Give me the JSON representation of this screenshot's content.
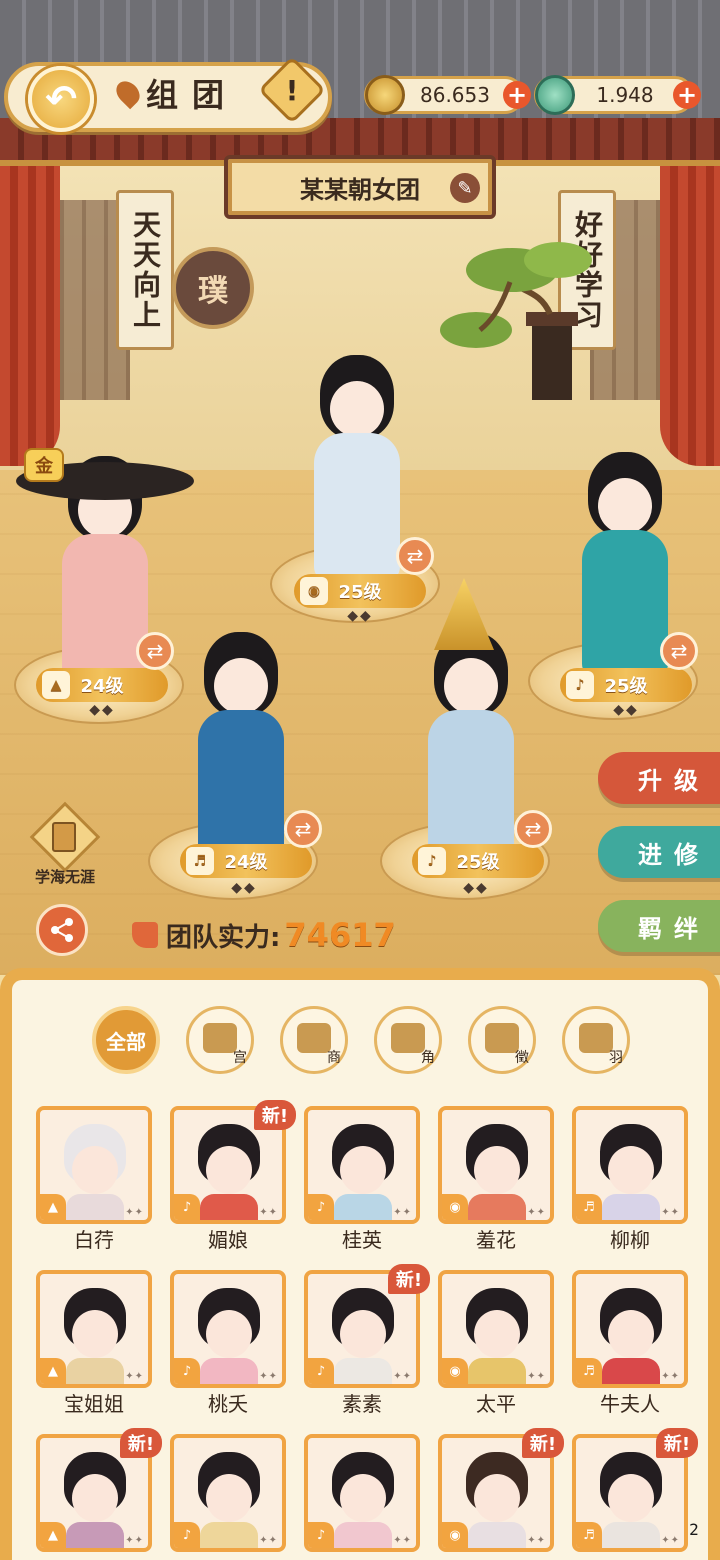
{
  "header": {
    "title": "组团",
    "info_label": "!",
    "back_label": "↶"
  },
  "currency": {
    "coins": "86.653",
    "jade": "1.948",
    "plus": "+"
  },
  "team": {
    "name": "某某朝女团",
    "banner_left": "天天向上",
    "banner_right": "好好学习",
    "seal": "璞",
    "gold_badge": "金"
  },
  "stage": {
    "members": [
      {
        "level": "25级",
        "stars": "◆◆",
        "color": "#dbe7f1"
      },
      {
        "level": "24级",
        "stars": "◆◆",
        "color": "#f2b7b0"
      },
      {
        "level": "25级",
        "stars": "◆◆",
        "color": "#2fa4a6"
      },
      {
        "level": "24级",
        "stars": "◆◆",
        "color": "#2f73a9"
      },
      {
        "level": "25级",
        "stars": "◆◆",
        "color": "#bcd4e6"
      }
    ]
  },
  "side_buttons": {
    "upgrade": "升级",
    "train": "进修",
    "bond": "羁绊"
  },
  "study_label": "学海无涯",
  "power": {
    "label": "团队实力:",
    "value": "74617"
  },
  "filters": {
    "all": "全部",
    "tones": [
      "宫",
      "商",
      "角",
      "徵",
      "羽"
    ]
  },
  "characters": [
    {
      "name": "白荇",
      "new": false,
      "robe": "#e8dadb",
      "hair": "#e9e6e8"
    },
    {
      "name": "媚娘",
      "new": true,
      "robe": "#e05a4a",
      "hair": "#231d20"
    },
    {
      "name": "桂英",
      "new": false,
      "robe": "#b9d6e6",
      "hair": "#231d20"
    },
    {
      "name": "羞花",
      "new": false,
      "robe": "#e67a5e",
      "hair": "#231d20"
    },
    {
      "name": "柳柳",
      "new": false,
      "robe": "#d8d3e8",
      "hair": "#231d20"
    },
    {
      "name": "宝姐姐",
      "new": false,
      "robe": "#e9d2a2",
      "hair": "#231d20"
    },
    {
      "name": "桃夭",
      "new": false,
      "robe": "#f2b7c2",
      "hair": "#231d20"
    },
    {
      "name": "素素",
      "new": true,
      "robe": "#ece8e3",
      "hair": "#231d20"
    },
    {
      "name": "太平",
      "new": false,
      "robe": "#e7c56a",
      "hair": "#231d20"
    },
    {
      "name": "牛夫人",
      "new": false,
      "robe": "#d9484a",
      "hair": "#231d20"
    },
    {
      "name": "",
      "new": true,
      "robe": "#c79ab7",
      "hair": "#231d20"
    },
    {
      "name": "",
      "new": false,
      "robe": "#eed69a",
      "hair": "#231d20"
    },
    {
      "name": "",
      "new": false,
      "robe": "#f1c7cf",
      "hair": "#231d20"
    },
    {
      "name": "",
      "new": true,
      "robe": "#e8dfe2",
      "hair": "#3d2a22"
    },
    {
      "name": "",
      "new": true,
      "robe": "#eae4df",
      "hair": "#231d20"
    }
  ],
  "new_tag": "新!",
  "user_id": "id:159222",
  "colors": {
    "accent": "#e8ac4c",
    "upgrade": "#d5573a",
    "train": "#3fa99d",
    "bond": "#88b35d",
    "power": "#f08a24"
  }
}
